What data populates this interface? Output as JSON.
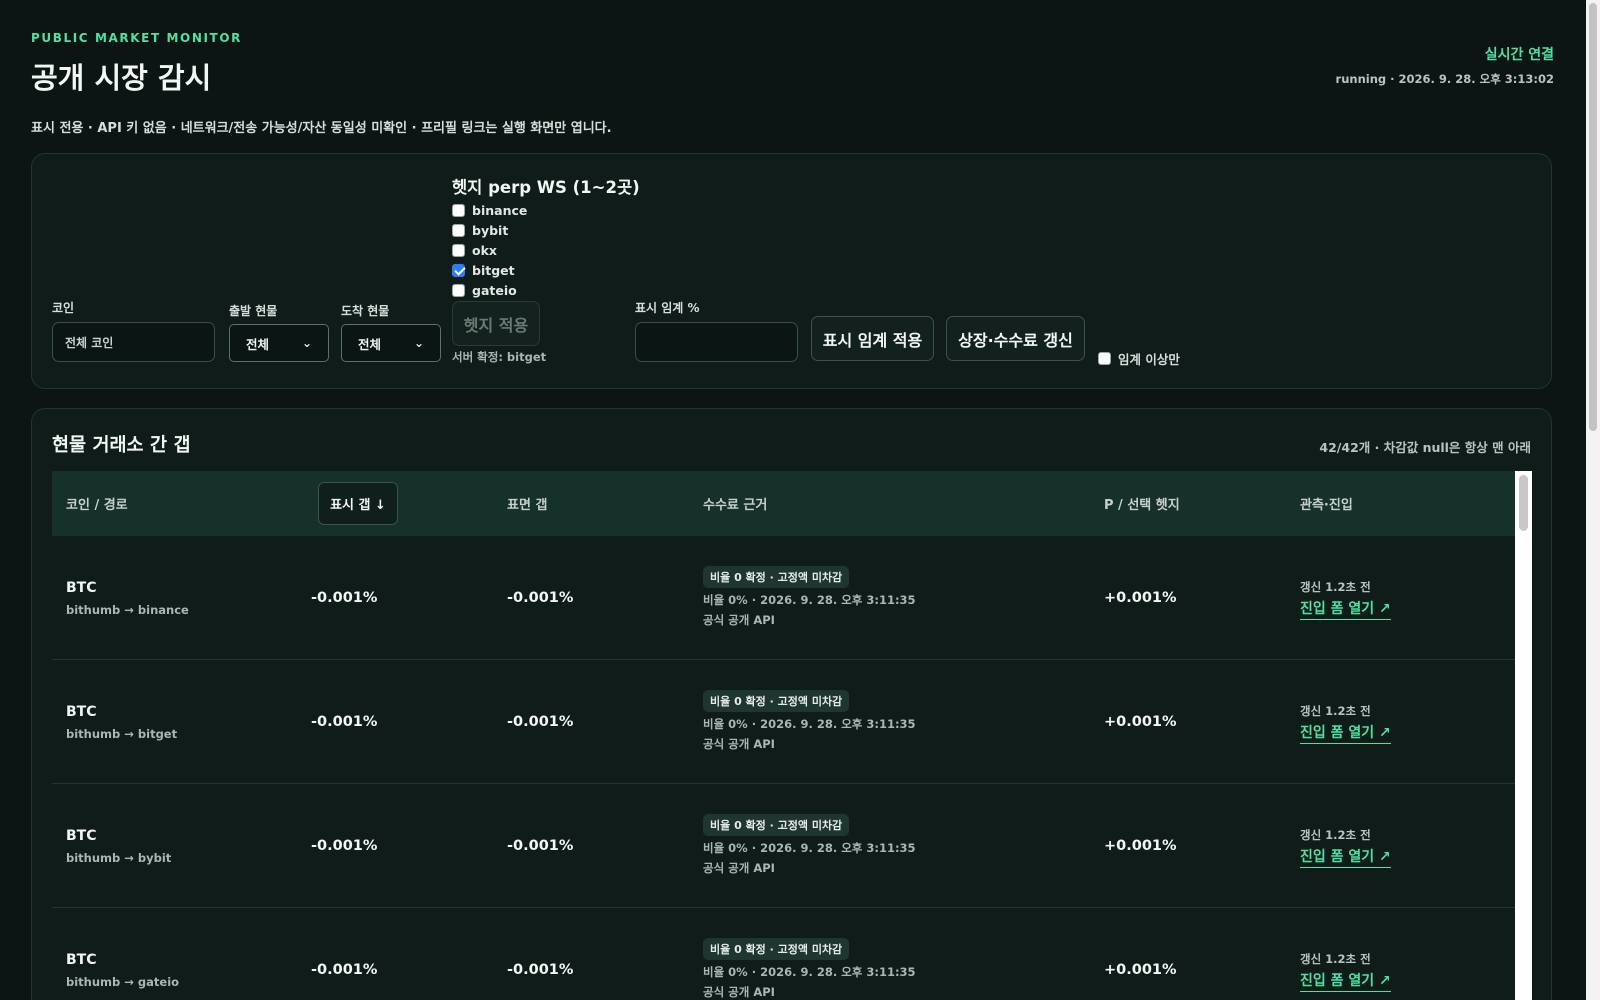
{
  "header": {
    "eyebrow": "PUBLIC MARKET MONITOR",
    "title": "공개 시장 감시",
    "subtitle": "표시 전용 · API 키 없음 · 네트워크/전송 가능성/자산 동일성 미확인 · 프리필 링크는 실행 화면만 엽니다.",
    "status_title": "실시간 연결",
    "status_time": "running · 2026. 9. 28. 오후 3:13:02"
  },
  "controls": {
    "coin_label": "코인",
    "coin_placeholder": "전체 코인",
    "from_label": "출발 현물",
    "from_value": "전체",
    "to_label": "도착 현물",
    "to_value": "전체",
    "hedge_title": "헷지 perp WS (1~2곳)",
    "hedge_options": [
      {
        "label": "binance",
        "checked": false
      },
      {
        "label": "bybit",
        "checked": false
      },
      {
        "label": "okx",
        "checked": false
      },
      {
        "label": "bitget",
        "checked": true
      },
      {
        "label": "gateio",
        "checked": false
      }
    ],
    "hedge_apply": "헷지 적용",
    "hedge_hint": "서버 확정: bitget",
    "threshold_label": "표시 임계 %",
    "threshold_value": "",
    "threshold_apply": "표시 임계 적용",
    "refresh": "상장·수수료 갱신",
    "only_above": "임계 이상만"
  },
  "table": {
    "title": "현물 거래소 간 갭",
    "count": "42/42개 · 차감값 null은 항상 맨 아래",
    "columns": [
      "코인 / 경로",
      "표시 갭 ↓",
      "표면 갭",
      "수수료 근거",
      "P / 선택 헷지",
      "관측·진입"
    ],
    "rows": [
      {
        "coin": "BTC",
        "route": "bithumb → binance",
        "display_gap": "-0.001%",
        "surface_gap": "-0.001%",
        "fee_badge": "비율 0 확정 · 고정액 미차감",
        "fee_detail": "비율 0% · 2026. 9. 28. 오후 3:11:35",
        "fee_source": "공식 공개 API",
        "hedge": "+0.001%",
        "fresh": "갱신 1.2초 전",
        "entry": "진입 폼 열기 ↗"
      },
      {
        "coin": "BTC",
        "route": "bithumb → bitget",
        "display_gap": "-0.001%",
        "surface_gap": "-0.001%",
        "fee_badge": "비율 0 확정 · 고정액 미차감",
        "fee_detail": "비율 0% · 2026. 9. 28. 오후 3:11:35",
        "fee_source": "공식 공개 API",
        "hedge": "+0.001%",
        "fresh": "갱신 1.2초 전",
        "entry": "진입 폼 열기 ↗"
      },
      {
        "coin": "BTC",
        "route": "bithumb → bybit",
        "display_gap": "-0.001%",
        "surface_gap": "-0.001%",
        "fee_badge": "비율 0 확정 · 고정액 미차감",
        "fee_detail": "비율 0% · 2026. 9. 28. 오후 3:11:35",
        "fee_source": "공식 공개 API",
        "hedge": "+0.001%",
        "fresh": "갱신 1.2초 전",
        "entry": "진입 폼 열기 ↗"
      },
      {
        "coin": "BTC",
        "route": "bithumb → gateio",
        "display_gap": "-0.001%",
        "surface_gap": "-0.001%",
        "fee_badge": "비율 0 확정 · 고정액 미차감",
        "fee_detail": "비율 0% · 2026. 9. 28. 오후 3:11:35",
        "fee_source": "공식 공개 API",
        "hedge": "+0.001%",
        "fresh": "갱신 1.2초 전",
        "entry": "진입 폼 열기 ↗"
      }
    ]
  },
  "colors": {
    "accent": "#4fe0a3",
    "background": "#0c1513",
    "panel": "#0f1c19",
    "table_header": "#16302a",
    "checkbox_checked": "#2f7cf6"
  },
  "icons": {
    "select_arrow": "chevron-down-icon",
    "entry_link": "external-link-icon",
    "sort": "arrow-down-icon"
  }
}
